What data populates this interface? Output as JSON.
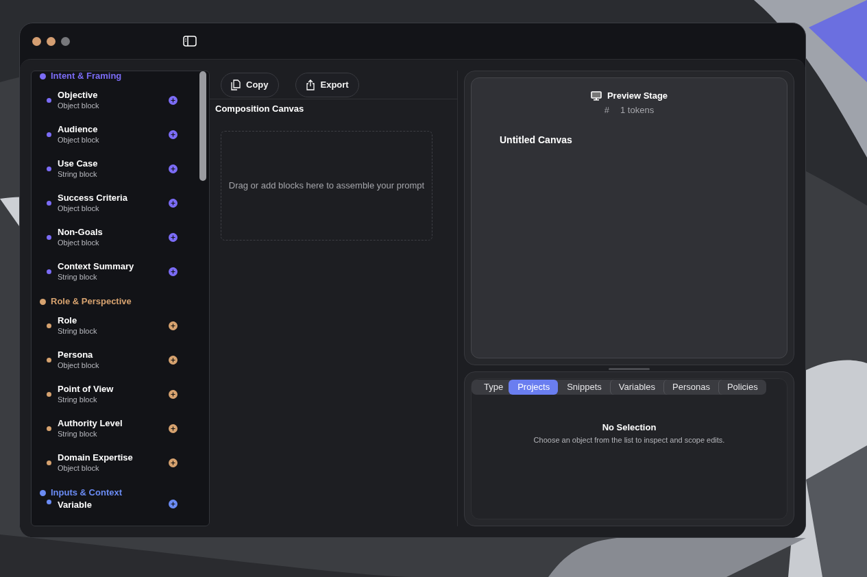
{
  "toolbar": {
    "buttons": [
      {
        "kind": "copy",
        "label": "Copy"
      },
      {
        "kind": "export",
        "label": "Export"
      }
    ]
  },
  "sidebar": {
    "sections": [
      {
        "title": "Intent & Framing",
        "color": "#7b6cf6",
        "items": [
          {
            "name": "Objective",
            "subtitle": "Object block"
          },
          {
            "name": "Audience",
            "subtitle": "Object block"
          },
          {
            "name": "Use Case",
            "subtitle": "String block"
          },
          {
            "name": "Success Criteria",
            "subtitle": "Object block"
          },
          {
            "name": "Non-Goals",
            "subtitle": "Object block"
          },
          {
            "name": "Context Summary",
            "subtitle": "String block"
          }
        ]
      },
      {
        "title": "Role & Perspective",
        "color": "#d6a26f",
        "items": [
          {
            "name": "Role",
            "subtitle": "String block"
          },
          {
            "name": "Persona",
            "subtitle": "Object block"
          },
          {
            "name": "Point of View",
            "subtitle": "String block"
          },
          {
            "name": "Authority Level",
            "subtitle": "String block"
          },
          {
            "name": "Domain Expertise",
            "subtitle": "Object block"
          }
        ]
      },
      {
        "title": "Inputs & Context",
        "color": "#6b8cf5",
        "items": [
          {
            "name": "Variable"
          }
        ]
      }
    ]
  },
  "canvas": {
    "title": "Composition Canvas",
    "placeholder": "Drag or add blocks here to assemble your prompt"
  },
  "preview": {
    "title": "Preview Stage",
    "token_symbol": "#",
    "tokens": "1 tokens",
    "canvas_title": "Untitled Canvas"
  },
  "inspector": {
    "type_label": "Type",
    "tabs": [
      {
        "label": "Projects",
        "selected": true
      },
      {
        "label": "Snippets",
        "selected": false
      },
      {
        "label": "Variables",
        "selected": false
      },
      {
        "label": "Personas",
        "selected": false
      },
      {
        "label": "Policies",
        "selected": false
      }
    ],
    "empty_title": "No Selection",
    "empty_text": "Choose an object from the list to inspect and scope edits."
  }
}
